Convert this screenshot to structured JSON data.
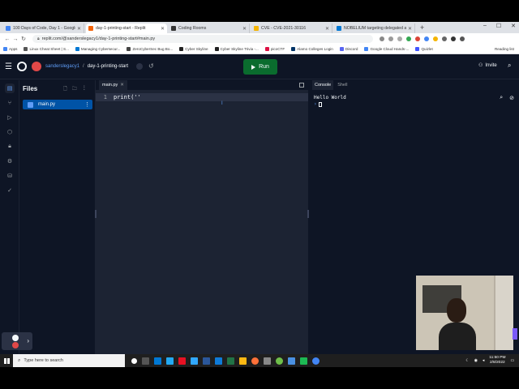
{
  "browser": {
    "tabs": [
      {
        "title": "100 Days of Code, Day 1 - Google",
        "color": "#4285f4",
        "active": false
      },
      {
        "title": "day-1-printing-start - Replit",
        "color": "#f26207",
        "active": true
      },
      {
        "title": "Coding Rooms",
        "color": "#333333",
        "active": false
      },
      {
        "title": "CVE - CVE-2021-30116",
        "color": "#f4b400",
        "active": false
      },
      {
        "title": "NOBELIUM targeting delegated ad",
        "color": "#0078d4",
        "active": false
      }
    ],
    "url": "replit.com/@sanderslegacy1/day-1-printing-start#main.py",
    "bookmarks": [
      "Apps",
      "Linux Cheat Sheet | S...",
      "Managing Cybersecur...",
      "ZeroCyberSec Bug Bo...",
      "Cyber Skyline",
      "Cyber Skyline Trivia -...",
      "picoCTF",
      "Alamo Colleges Login",
      "Discord",
      "Google Cloud Hands-...",
      "Quizlet"
    ],
    "reading_list": "Reading list"
  },
  "replit": {
    "username": "sanderslegacy1",
    "separator": "/",
    "repl_name": "day-1-printing-start",
    "run_label": "Run",
    "invite_label": "Invite",
    "files_title": "Files",
    "files": [
      "main.py"
    ],
    "editor_tab": "main.py",
    "code_lines": [
      {
        "num": "1",
        "text": "print(''"
      }
    ],
    "console_tabs": [
      "Console",
      "Shell"
    ],
    "console_output": "Hello World",
    "console_prompt": "›",
    "accent": "#0053a6",
    "run_color": "#0a6c2e"
  },
  "taskbar": {
    "search_placeholder": "Type here to search",
    "time": "11:50 PM",
    "date": "2/8/2022"
  }
}
